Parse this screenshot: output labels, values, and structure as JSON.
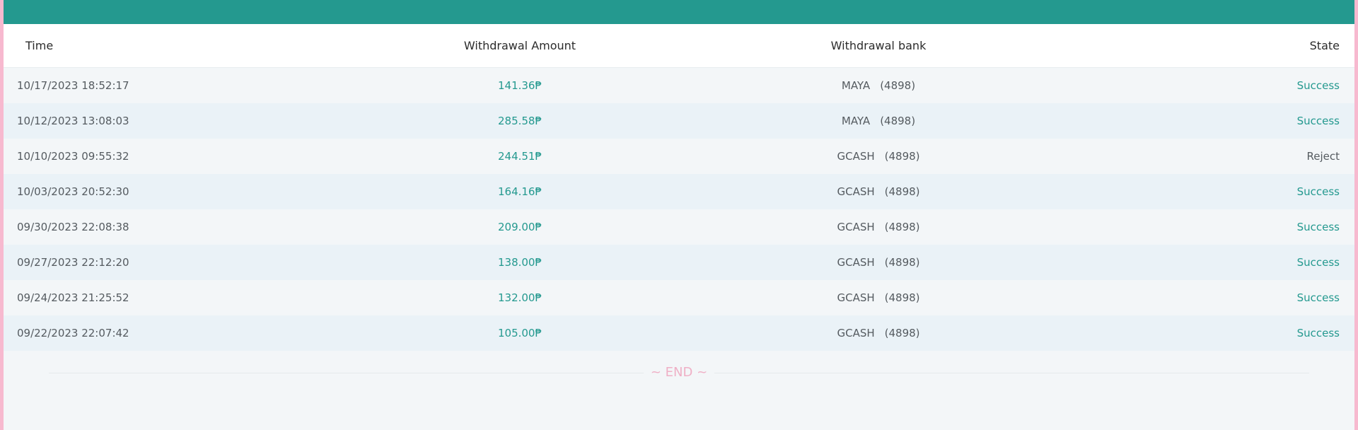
{
  "colors": {
    "header_bar": "#24998f",
    "accent": "#24998f",
    "reject": "#555b60",
    "end_marker": "#efb0c6",
    "frame_border": "#f7b9cf"
  },
  "table": {
    "headers": {
      "time": "Time",
      "amount": "Withdrawal Amount",
      "bank": "Withdrawal bank",
      "state": "State"
    },
    "rows": [
      {
        "time": "10/17/2023 18:52:17",
        "amount": "141.36₱",
        "bank": "MAYA",
        "account": "(4898)",
        "state": "Success"
      },
      {
        "time": "10/12/2023 13:08:03",
        "amount": "285.58₱",
        "bank": "MAYA",
        "account": "(4898)",
        "state": "Success"
      },
      {
        "time": "10/10/2023 09:55:32",
        "amount": "244.51₱",
        "bank": "GCASH",
        "account": "(4898)",
        "state": "Reject"
      },
      {
        "time": "10/03/2023 20:52:30",
        "amount": "164.16₱",
        "bank": "GCASH",
        "account": "(4898)",
        "state": "Success"
      },
      {
        "time": "09/30/2023 22:08:38",
        "amount": "209.00₱",
        "bank": "GCASH",
        "account": "(4898)",
        "state": "Success"
      },
      {
        "time": "09/27/2023 22:12:20",
        "amount": "138.00₱",
        "bank": "GCASH",
        "account": "(4898)",
        "state": "Success"
      },
      {
        "time": "09/24/2023 21:25:52",
        "amount": "132.00₱",
        "bank": "GCASH",
        "account": "(4898)",
        "state": "Success"
      },
      {
        "time": "09/22/2023 22:07:42",
        "amount": "105.00₱",
        "bank": "GCASH",
        "account": "(4898)",
        "state": "Success"
      }
    ]
  },
  "end_marker": "~ END ~"
}
